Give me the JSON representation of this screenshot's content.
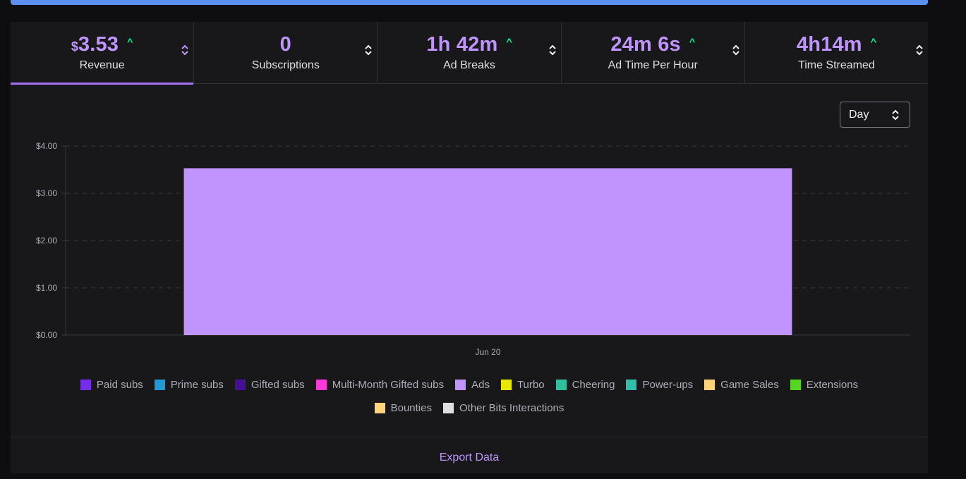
{
  "stats": [
    {
      "currency": "$",
      "value": "3.53",
      "label": "Revenue",
      "trend": "up",
      "active": true
    },
    {
      "value": "0",
      "label": "Subscriptions",
      "trend": "",
      "active": false
    },
    {
      "value": "1h 42m",
      "label": "Ad Breaks",
      "trend": "up",
      "active": false
    },
    {
      "value": "24m 6s",
      "label": "Ad Time Per Hour",
      "trend": "up",
      "active": false
    },
    {
      "value": "4h14m",
      "label": "Time Streamed",
      "trend": "up",
      "active": false
    }
  ],
  "period_select": {
    "value": "Day"
  },
  "chart_data": {
    "type": "bar",
    "categories": [
      "Jun 20"
    ],
    "series": [
      {
        "name": "Ads",
        "values": [
          3.53
        ],
        "color": "#bf94ff"
      }
    ],
    "ylim": [
      0,
      4
    ],
    "yticks": [
      "$0.00",
      "$1.00",
      "$2.00",
      "$3.00",
      "$4.00"
    ],
    "ytick_values": [
      0,
      1,
      2,
      3,
      4
    ],
    "grid": true,
    "title": "",
    "xlabel": "",
    "ylabel": ""
  },
  "legend": {
    "rows": [
      [
        {
          "label": "Paid subs",
          "color": "#772ce8"
        },
        {
          "label": "Prime subs",
          "color": "#1f9ad6"
        },
        {
          "label": "Gifted subs",
          "color": "#451093"
        },
        {
          "label": "Multi-Month Gifted subs",
          "color": "#ff38db"
        },
        {
          "label": "Ads",
          "color": "#bf94ff"
        },
        {
          "label": "Turbo",
          "color": "#e8e800"
        },
        {
          "label": "Cheering",
          "color": "#2fbf9f"
        },
        {
          "label": "Power-ups",
          "color": "#2fbfa8"
        },
        {
          "label": "Game Sales",
          "color": "#ffd37a"
        },
        {
          "label": "Extensions",
          "color": "#57d61f"
        }
      ],
      [
        {
          "label": "Bounties",
          "color": "#ffd37a"
        },
        {
          "label": "Other Bits Interactions",
          "color": "#dedee3"
        }
      ]
    ]
  },
  "footer": {
    "export_label": "Export Data"
  }
}
